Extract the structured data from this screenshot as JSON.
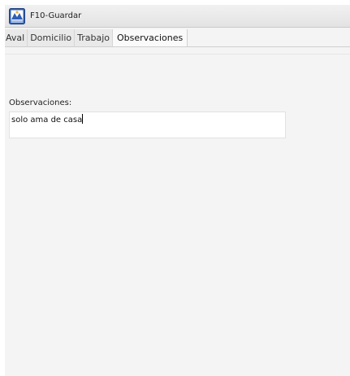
{
  "toolbar": {
    "save_label": "F10-Guardar",
    "save_icon": "save-app-icon"
  },
  "tabs": [
    {
      "label": "Aval",
      "active": false
    },
    {
      "label": "Domicilio",
      "active": false
    },
    {
      "label": "Trabajo",
      "active": false
    },
    {
      "label": "Observaciones",
      "active": true
    }
  ],
  "observaciones": {
    "label": "Observaciones:",
    "value": "solo ama de casa"
  },
  "colors": {
    "panel_bg": "#f4f4f4",
    "icon_blue": "#2f5fb5"
  }
}
